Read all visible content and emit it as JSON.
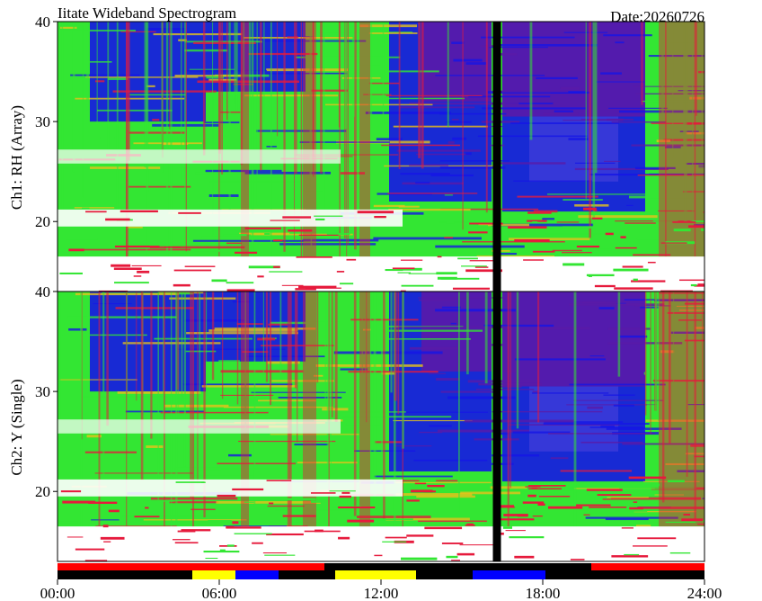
{
  "chart_data": {
    "type": "heatmap",
    "title": "Iitate Wideband Spectrogram",
    "date": "Date:20260726",
    "xlabel": "",
    "x_ticks": [
      "00:00",
      "06:00",
      "12:00",
      "18:00",
      "24:00"
    ],
    "xlim_hours": [
      0,
      24
    ],
    "colors": {
      "low": "#5a1aa8",
      "mid": "#1515e6",
      "high": "#33e633",
      "peak": "#e61a3c",
      "saturated": "#ffffff",
      "gap": "#000000"
    },
    "data_gap_hours": [
      16.15,
      16.45
    ],
    "panels": [
      {
        "ylabel": "Ch1: RH (Array)",
        "y_ticks": [
          20,
          30,
          40
        ],
        "ylim": [
          13,
          40
        ]
      },
      {
        "ylabel": "Ch2: Y (Single)",
        "y_ticks": [
          20,
          30,
          40
        ],
        "ylim": [
          13,
          40
        ]
      }
    ],
    "status_bars": [
      {
        "segments": [
          {
            "start": 0,
            "end": 9.9,
            "color": "red"
          },
          {
            "start": 9.9,
            "end": 19.8,
            "color": "black"
          },
          {
            "start": 19.8,
            "end": 24,
            "color": "red"
          }
        ]
      },
      {
        "segments": [
          {
            "start": 0,
            "end": 5.0,
            "color": "black"
          },
          {
            "start": 5.0,
            "end": 6.6,
            "color": "yellow"
          },
          {
            "start": 6.6,
            "end": 8.2,
            "color": "blue"
          },
          {
            "start": 8.2,
            "end": 10.3,
            "color": "black"
          },
          {
            "start": 10.3,
            "end": 13.3,
            "color": "yellow"
          },
          {
            "start": 13.3,
            "end": 15.4,
            "color": "black"
          },
          {
            "start": 15.4,
            "end": 18.1,
            "color": "blue"
          },
          {
            "start": 18.1,
            "end": 24,
            "color": "black"
          }
        ]
      }
    ]
  }
}
